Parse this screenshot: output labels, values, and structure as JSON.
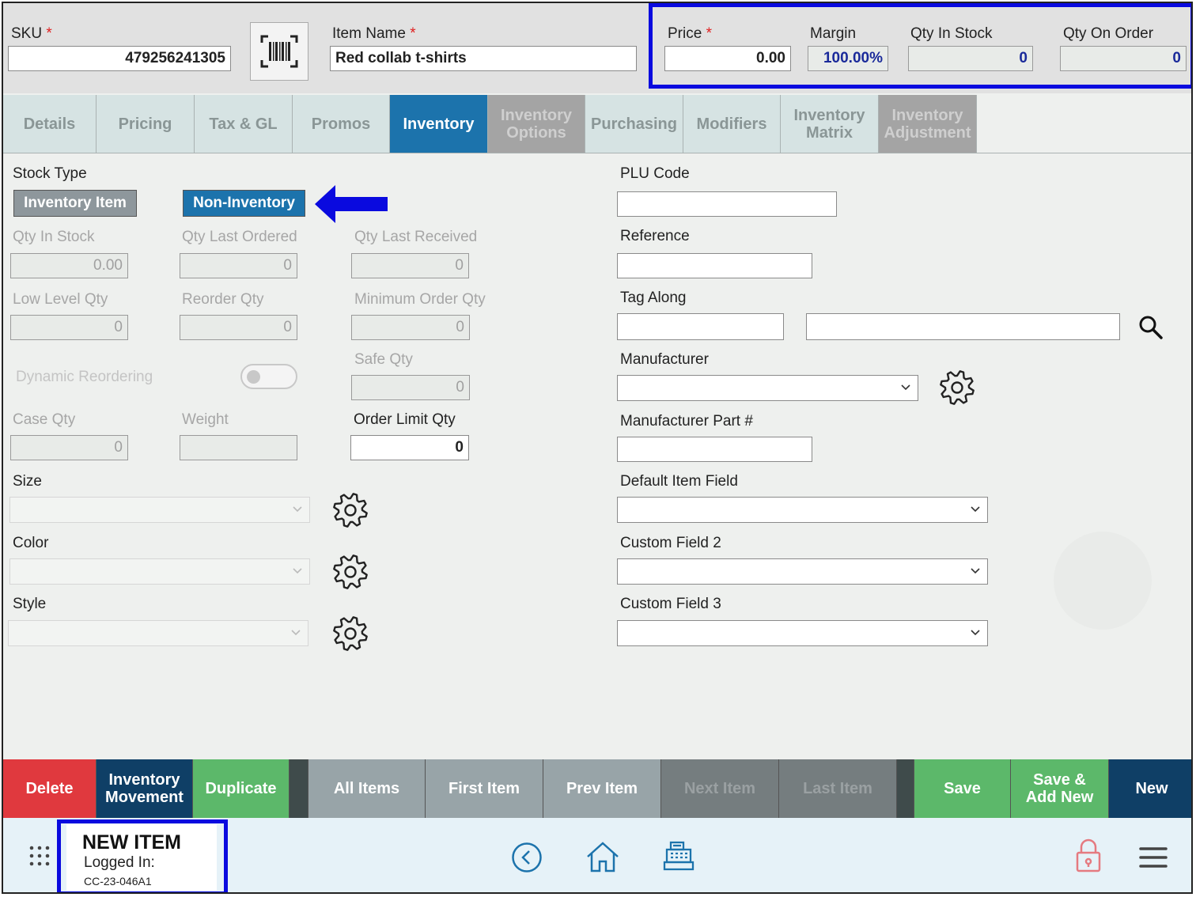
{
  "header": {
    "sku_label": "SKU",
    "sku_value": "479256241305",
    "item_name_label": "Item Name",
    "item_name_value": "Red collab t-shirts",
    "required_marker": "*",
    "price_label": "Price",
    "price_value": "0.00",
    "margin_label": "Margin",
    "margin_value": "100.00%",
    "qty_in_stock_label": "Qty In Stock",
    "qty_in_stock_value": "0",
    "qty_on_order_label": "Qty On Order",
    "qty_on_order_value": "0"
  },
  "tabs": [
    {
      "label": "Details"
    },
    {
      "label": "Pricing"
    },
    {
      "label": "Tax & GL"
    },
    {
      "label": "Promos"
    },
    {
      "label": "Inventory"
    },
    {
      "label": "Inventory Options"
    },
    {
      "label": "Purchasing"
    },
    {
      "label": "Modifiers"
    },
    {
      "label": "Inventory Matrix"
    },
    {
      "label": "Inventory Adjustment"
    }
  ],
  "inventory": {
    "stock_type_label": "Stock Type",
    "inventory_item_label": "Inventory Item",
    "non_inventory_label": "Non-Inventory",
    "qty_in_stock_label": "Qty In Stock",
    "qty_in_stock_value": "0.00",
    "qty_last_ordered_label": "Qty Last Ordered",
    "qty_last_ordered_value": "0",
    "qty_last_received_label": "Qty Last Received",
    "qty_last_received_value": "0",
    "low_level_qty_label": "Low Level Qty",
    "low_level_qty_value": "0",
    "reorder_qty_label": "Reorder Qty",
    "reorder_qty_value": "0",
    "minimum_order_qty_label": "Minimum Order Qty",
    "minimum_order_qty_value": "0",
    "dynamic_reordering_label": "Dynamic Reordering",
    "safe_qty_label": "Safe Qty",
    "safe_qty_value": "0",
    "case_qty_label": "Case Qty",
    "case_qty_value": "0",
    "weight_label": "Weight",
    "weight_value": "",
    "order_limit_qty_label": "Order Limit Qty",
    "order_limit_qty_value": "0",
    "size_label": "Size",
    "color_label": "Color",
    "style_label": "Style"
  },
  "right": {
    "plu_code_label": "PLU Code",
    "reference_label": "Reference",
    "tag_along_label": "Tag Along",
    "manufacturer_label": "Manufacturer",
    "manufacturer_part_label": "Manufacturer Part #",
    "default_item_field_label": "Default Item Field",
    "custom_field_2_label": "Custom Field 2",
    "custom_field_3_label": "Custom Field 3"
  },
  "actions": {
    "delete": "Delete",
    "inventory_movement": "Inventory Movement",
    "duplicate": "Duplicate",
    "all_items": "All Items",
    "first_item": "First Item",
    "prev_item": "Prev Item",
    "next_item": "Next Item",
    "last_item": "Last Item",
    "save": "Save",
    "save_add_new": "Save & Add New",
    "new": "New"
  },
  "footer": {
    "title": "NEW ITEM",
    "logged_in_label": "Logged In:",
    "user": "CC-23-046A1"
  },
  "colors": {
    "active_tab": "#1c73ac",
    "delete": "#e0393e",
    "green": "#5cb86a",
    "navy": "#0f3f66",
    "highlight": "#0a0adf"
  }
}
